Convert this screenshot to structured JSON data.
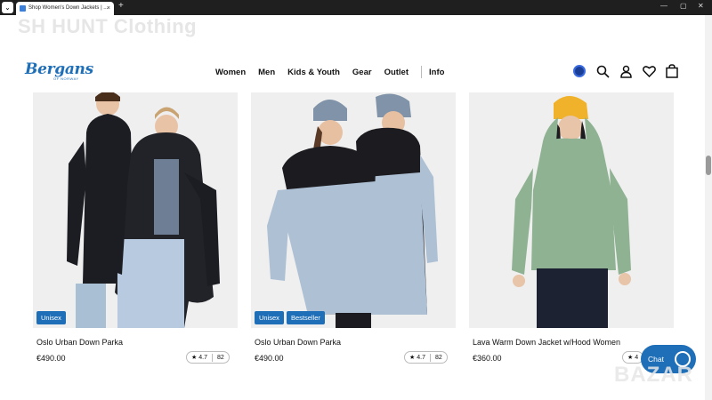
{
  "browser": {
    "tab_title": "Shop Women's Down Jackets | ...",
    "tab_close": "×",
    "new_tab": "+",
    "minimize": "—",
    "maximize": "▢",
    "close": "✕"
  },
  "watermark": "SH HUNT Clothing",
  "site": {
    "logo": "Bergans",
    "logo_sub": "OF NORWAY",
    "nav": [
      "Women",
      "Men",
      "Kids & Youth",
      "Gear",
      "Outlet",
      "Info"
    ]
  },
  "products": [
    {
      "name": "Oslo Urban Down Parka",
      "price": "€490.00",
      "rating": "4.7",
      "reviews": "82",
      "badges": [
        "Unisex"
      ],
      "colors": {
        "jacket": "#1c1d22",
        "jacket2": "#222328",
        "pants": "#a9bfd3",
        "skin": "#e9c3a6"
      }
    },
    {
      "name": "Oslo Urban Down Parka",
      "price": "€490.00",
      "rating": "4.7",
      "reviews": "82",
      "badges": [
        "Unisex",
        "Bestseller"
      ],
      "colors": {
        "jacket": "#aec0d4",
        "top": "#1c1c20",
        "hat": "#8193a8",
        "skin": "#e7c0a1"
      }
    },
    {
      "name": "Lava Warm Down Jacket w/Hood Women",
      "price": "€360.00",
      "rating": "4",
      "reviews": "",
      "badges": [],
      "colors": {
        "jacket": "#8fb293",
        "pants": "#1d2233",
        "hat": "#f0b22a",
        "skin": "#e8c4a8"
      }
    }
  ],
  "chat": {
    "label": "Chat"
  },
  "bottom_watermark": "BAZAR"
}
